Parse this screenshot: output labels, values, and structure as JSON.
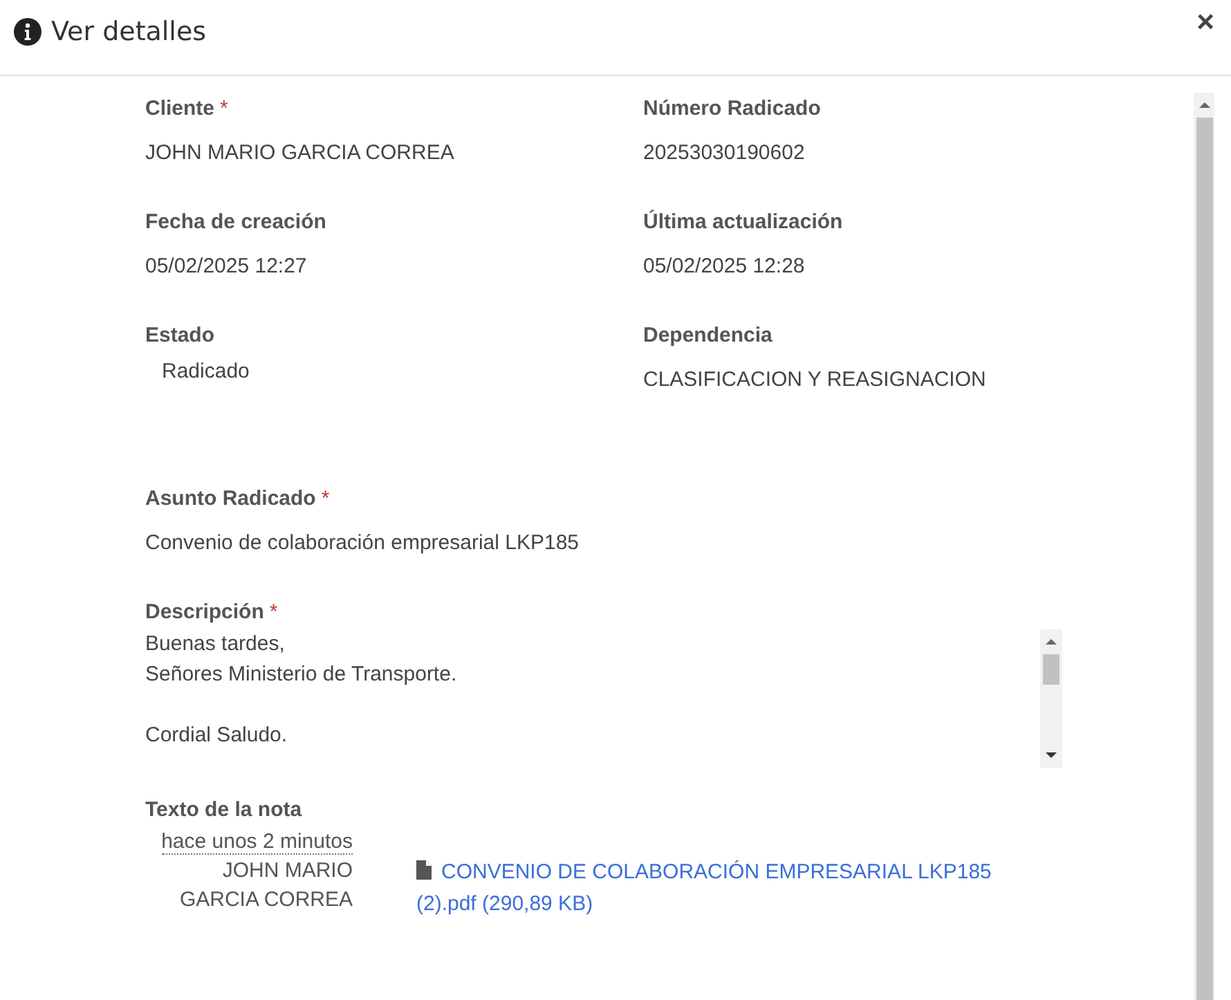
{
  "dialog": {
    "title": "Ver detalles",
    "close": "×"
  },
  "fields": [
    {
      "label": "Cliente",
      "required_mark": "*",
      "value": "JOHN MARIO GARCIA CORREA",
      "indented": false
    },
    {
      "label": "Número Radicado",
      "value": "20253030190602",
      "indented": false
    },
    {
      "label": "Fecha de creación",
      "value": "05/02/2025 12:27",
      "indented": false
    },
    {
      "label": "Última actualización",
      "value": "05/02/2025 12:28",
      "indented": false
    },
    {
      "label": "Estado",
      "value": "Radicado",
      "indented": true
    },
    {
      "label": "Dependencia",
      "value": "CLASIFICACION Y REASIGNACION",
      "indented": false
    }
  ],
  "subject": {
    "label": "Asunto Radicado",
    "required_mark": "*",
    "value": "Convenio de colaboración empresarial LKP185"
  },
  "description": {
    "label": "Descripción",
    "required_mark": "*",
    "value": "Buenas tardes,\nSeñores Ministerio de Transporte.\n\nCordial Saludo."
  },
  "note": {
    "label": "Texto de la nota",
    "time": "hace unos 2 minutos",
    "author": "JOHN MARIO GARCIA CORREA",
    "attachment": "CONVENIO DE COLABORACIÓN EMPRESARIAL LKP185 (2).pdf (290,89 KB)"
  }
}
